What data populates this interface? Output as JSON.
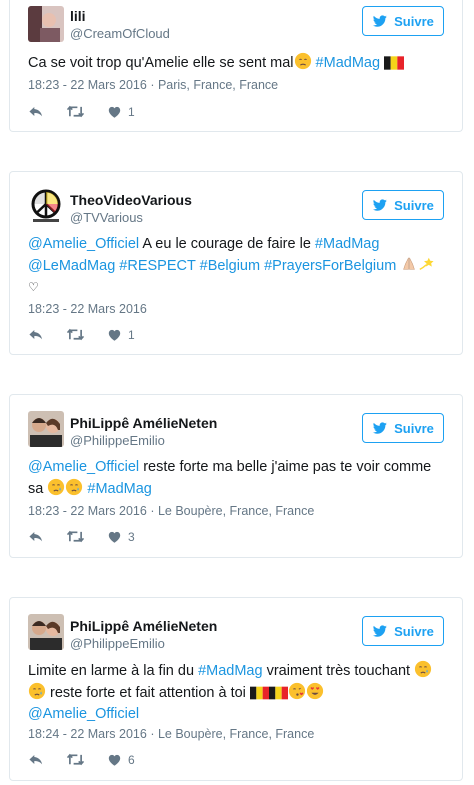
{
  "follow_label": "Suivre",
  "tweets": [
    {
      "name": "lili",
      "handle": "@CreamOfCloud",
      "text": {
        "t1": "Ca se voit trop qu'Amelie elle se sent mal",
        "tag1": "#MadMag"
      },
      "time": "18:23 - 22 Mars 2016",
      "location": "Paris, France, France",
      "likes": "1"
    },
    {
      "name": "TheoVideoVarious",
      "handle": "@TVVarious",
      "text": {
        "mention1": "@Amelie_Officiel",
        "t1": "A eu le courage de faire le",
        "tag1": "#MadMag",
        "mention2": "@LeMadMag",
        "tag2": "#RESPECT",
        "tag3": "#Belgium",
        "tag4": "#PrayersForBelgium",
        "t2": "♡"
      },
      "time": "18:23 - 22 Mars 2016",
      "location": "",
      "likes": "1"
    },
    {
      "name": "PhiLippê AmélieNeten",
      "handle": "@PhilippeEmilio",
      "text": {
        "mention1": "@Amelie_Officiel",
        "t1": "reste forte ma belle j'aime pas te voir comme",
        "t2": "sa",
        "tag1": "#MadMag"
      },
      "time": "18:23 - 22 Mars 2016",
      "location": "Le Boupère, France, France",
      "likes": "3"
    },
    {
      "name": "PhiLippê AmélieNeten",
      "handle": "@PhilippeEmilio",
      "text": {
        "t1": "Limite en larme à la fin du",
        "tag1": "#MadMag",
        "t2": "vraiment très touchant",
        "t3": "reste forte et fait attention à toi",
        "mention1": "@Amelie_Officiel"
      },
      "time": "18:24 - 22 Mars 2016",
      "location": "Le Boupère, France, France",
      "likes": "6"
    }
  ],
  "colors": {
    "accent": "#1da1f2",
    "link": "#1b95e0",
    "muted": "#657786",
    "border": "#e1e8ed"
  }
}
